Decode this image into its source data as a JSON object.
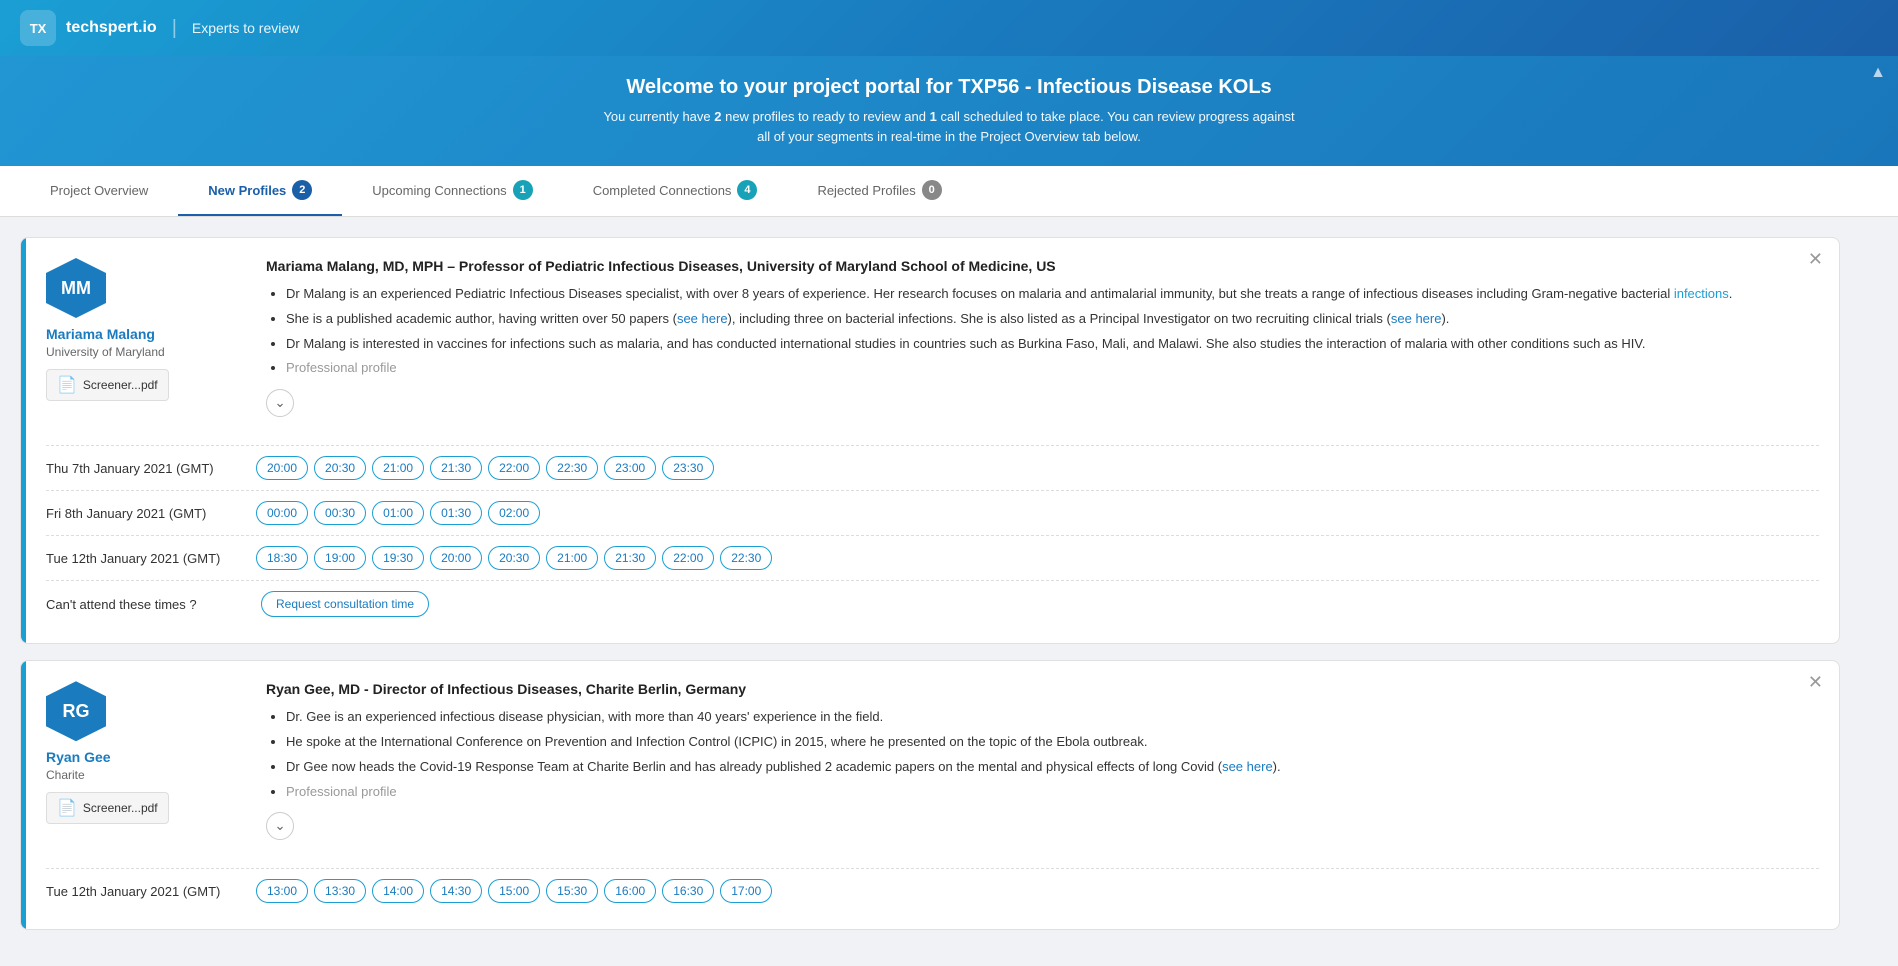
{
  "header": {
    "logo_icon": "TX",
    "logo_name": "techspert.io",
    "divider": "|",
    "subtitle": "Experts to review"
  },
  "banner": {
    "title": "Welcome to your project portal for TXP56 - Infectious Disease KOLs",
    "subtitle_pre": "You currently have ",
    "new_count": "2",
    "subtitle_mid": " new profiles to ready to review and ",
    "call_count": "1",
    "subtitle_post": " call scheduled to take place. You can review progress against all of your segments in real-time in the Project Overview tab below.",
    "collapse_icon": "▲"
  },
  "tabs": [
    {
      "label": "Project Overview",
      "badge": null,
      "active": false
    },
    {
      "label": "New Profiles",
      "badge": "2",
      "active": true
    },
    {
      "label": "Upcoming Connections",
      "badge": "1",
      "active": false
    },
    {
      "label": "Completed Connections",
      "badge": "4",
      "active": false
    },
    {
      "label": "Rejected Profiles",
      "badge": "0",
      "active": false
    }
  ],
  "profiles": [
    {
      "initials": "MM",
      "name": "Mariama Malang",
      "institution": "University of Maryland",
      "screener_label": "Screener...pdf",
      "headline": "Mariama Malang, MD, MPH – Professor of Pediatric Infectious Diseases, University of Maryland School of Medicine, US",
      "bullets": [
        "Dr Malang is an experienced Pediatric Infectious Diseases specialist, with over 8 years of experience. Her research focuses on malaria and antimalarial immunity, but she treats a range of infectious diseases including Gram-negative bacterial infections.",
        "She is a published academic author, having written over 50 papers (see here), including three on bacterial infections. She is also listed as a Principal Investigator on two recruiting clinical trials (see here).",
        "Dr Malang is interested in vaccines for infections such as malaria, and has conducted international studies in countries such as Burkina Faso, Mali, and Malawi. She also studies the interaction of malaria with other conditions such as HIV.",
        "Professional profile"
      ],
      "time_rows": [
        {
          "label": "Thu 7th January 2021 (GMT)",
          "slots": [
            "20:00",
            "20:30",
            "21:00",
            "21:30",
            "22:00",
            "22:30",
            "23:00",
            "23:30"
          ]
        },
        {
          "label": "Fri 8th January 2021 (GMT)",
          "slots": [
            "00:00",
            "00:30",
            "01:00",
            "01:30",
            "02:00"
          ]
        },
        {
          "label": "Tue 12th January 2021 (GMT)",
          "slots": [
            "18:30",
            "19:00",
            "19:30",
            "20:00",
            "20:30",
            "21:00",
            "21:30",
            "22:00",
            "22:30"
          ]
        }
      ],
      "cant_attend_label": "Can't attend these times ?",
      "request_btn_label": "Request consultation time"
    },
    {
      "initials": "RG",
      "name": "Ryan Gee",
      "institution": "Charite",
      "screener_label": "Screener...pdf",
      "headline": "Ryan Gee, MD - Director of Infectious Diseases, Charite Berlin, Germany",
      "bullets": [
        "Dr. Gee is an experienced infectious disease physician, with more than 40 years' experience in the field.",
        "He spoke at the International Conference on Prevention and Infection Control (ICPIC) in 2015, where he presented on the topic of the Ebola outbreak.",
        "Dr Gee now heads the Covid-19 Response Team at Charite Berlin and has already published 2 academic papers on the mental and physical effects of long Covid (see here).",
        "Professional profile"
      ],
      "time_rows": [
        {
          "label": "Tue 12th January 2021 (GMT)",
          "slots": [
            "13:00",
            "13:30",
            "14:00",
            "14:30",
            "15:00",
            "15:30",
            "16:00",
            "16:30",
            "17:00"
          ]
        }
      ],
      "cant_attend_label": null,
      "request_btn_label": null
    }
  ]
}
